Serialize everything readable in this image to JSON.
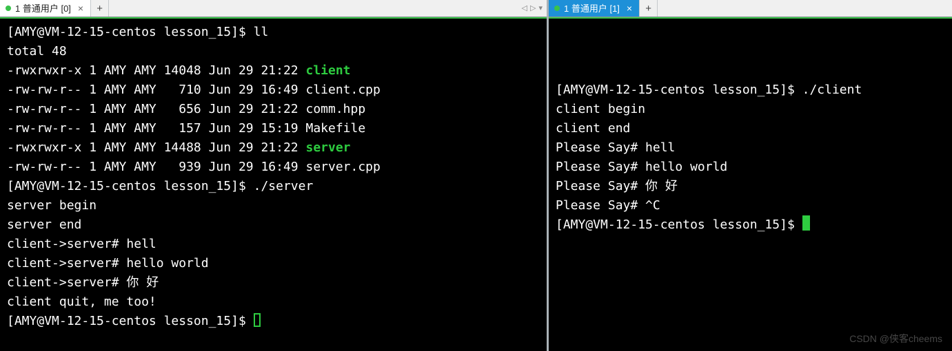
{
  "colors": {
    "exec": "#2ecc40",
    "tab_active_right": "#1e90d8",
    "dot": "#39c24a"
  },
  "left": {
    "tab": {
      "title": "1 普通用户 [0]",
      "active": true
    },
    "newtab_glyph": "+",
    "nav": {
      "prev": "◁",
      "next": "▷",
      "menu": "▾"
    },
    "prompt": "[AMY@VM-12-15-centos lesson_15]$ ",
    "lines": [
      {
        "kind": "prompt",
        "cmd": "ll"
      },
      {
        "kind": "plain",
        "text": "total 48"
      },
      {
        "kind": "ls",
        "perm": "-rwxrwxr-x",
        "links": "1",
        "own": "AMY",
        "grp": "AMY",
        "size": "14048",
        "date": "Jun 29 21:22",
        "name": "client",
        "exec": true
      },
      {
        "kind": "ls",
        "perm": "-rw-rw-r--",
        "links": "1",
        "own": "AMY",
        "grp": "AMY",
        "size": "  710",
        "date": "Jun 29 16:49",
        "name": "client.cpp"
      },
      {
        "kind": "ls",
        "perm": "-rw-rw-r--",
        "links": "1",
        "own": "AMY",
        "grp": "AMY",
        "size": "  656",
        "date": "Jun 29 21:22",
        "name": "comm.hpp"
      },
      {
        "kind": "ls",
        "perm": "-rw-rw-r--",
        "links": "1",
        "own": "AMY",
        "grp": "AMY",
        "size": "  157",
        "date": "Jun 29 15:19",
        "name": "Makefile"
      },
      {
        "kind": "ls",
        "perm": "-rwxrwxr-x",
        "links": "1",
        "own": "AMY",
        "grp": "AMY",
        "size": "14488",
        "date": "Jun 29 21:22",
        "name": "server",
        "exec": true
      },
      {
        "kind": "ls",
        "perm": "-rw-rw-r--",
        "links": "1",
        "own": "AMY",
        "grp": "AMY",
        "size": "  939",
        "date": "Jun 29 16:49",
        "name": "server.cpp"
      },
      {
        "kind": "prompt",
        "cmd": "./server"
      },
      {
        "kind": "plain",
        "text": "server begin"
      },
      {
        "kind": "plain",
        "text": "server end"
      },
      {
        "kind": "plain",
        "text": "client->server# hell"
      },
      {
        "kind": "plain",
        "text": "client->server# hello world"
      },
      {
        "kind": "plain",
        "text": "client->server# 你 好"
      },
      {
        "kind": "plain",
        "text": "client quit, me too!"
      },
      {
        "kind": "prompt",
        "cmd": "",
        "cursor": "hollow"
      }
    ]
  },
  "right": {
    "tab": {
      "title": "1 普通用户 [1]",
      "active": true
    },
    "newtab_glyph": "+",
    "prompt": "[AMY@VM-12-15-centos lesson_15]$ ",
    "lines": [
      {
        "kind": "prompt",
        "cmd": "./client"
      },
      {
        "kind": "plain",
        "text": "client begin"
      },
      {
        "kind": "plain",
        "text": "client end"
      },
      {
        "kind": "plain",
        "text": "Please Say# hell"
      },
      {
        "kind": "plain",
        "text": "Please Say# hello world"
      },
      {
        "kind": "plain",
        "text": "Please Say# 你 好"
      },
      {
        "kind": "plain",
        "text": "Please Say# ^C"
      },
      {
        "kind": "prompt",
        "cmd": "",
        "cursor": "solid"
      }
    ],
    "watermark": "CSDN @侠客cheems"
  }
}
